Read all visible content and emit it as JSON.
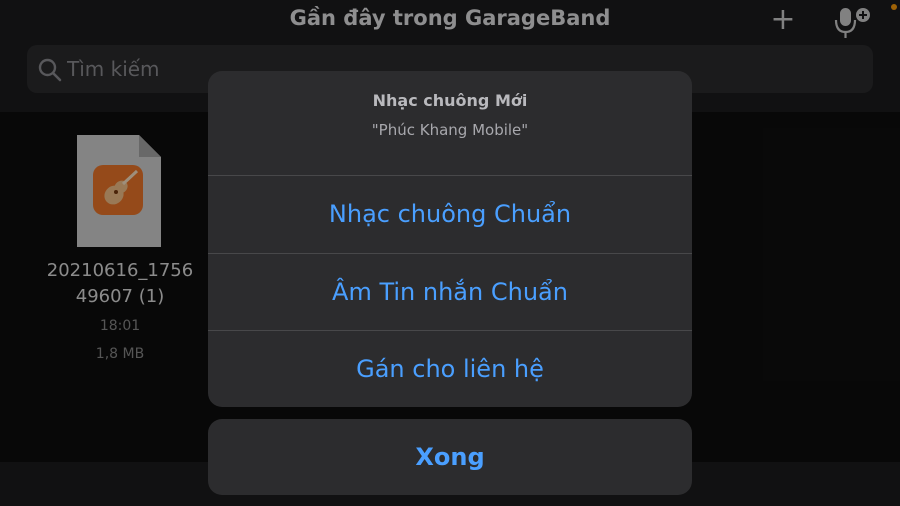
{
  "header": {
    "title": "Gần đây trong GarageBand",
    "add_icon": "plus-icon",
    "mic_icon": "mic-add-icon"
  },
  "search": {
    "placeholder": "Tìm kiếm",
    "icon": "search-icon"
  },
  "files": [
    {
      "name": "20210616_175649607 (1)",
      "time": "18:01",
      "size": "1,8 MB",
      "icon": "garageband-file-icon"
    }
  ],
  "action_sheet": {
    "title": "Nhạc chuông Mới",
    "message": "\"Phúc Khang Mobile\"",
    "actions": [
      {
        "label": "Nhạc chuông Chuẩn"
      },
      {
        "label": "Âm Tin nhắn Chuẩn"
      },
      {
        "label": "Gán cho liên hệ"
      }
    ],
    "cancel_label": "Xong"
  },
  "colors": {
    "accent": "#4a9fff",
    "sheet_bg": "#2c2c2e",
    "bar_bg": "#1c1c1e",
    "garageband_orange": "#f0782a",
    "status_dot": "#ff9f0a"
  }
}
